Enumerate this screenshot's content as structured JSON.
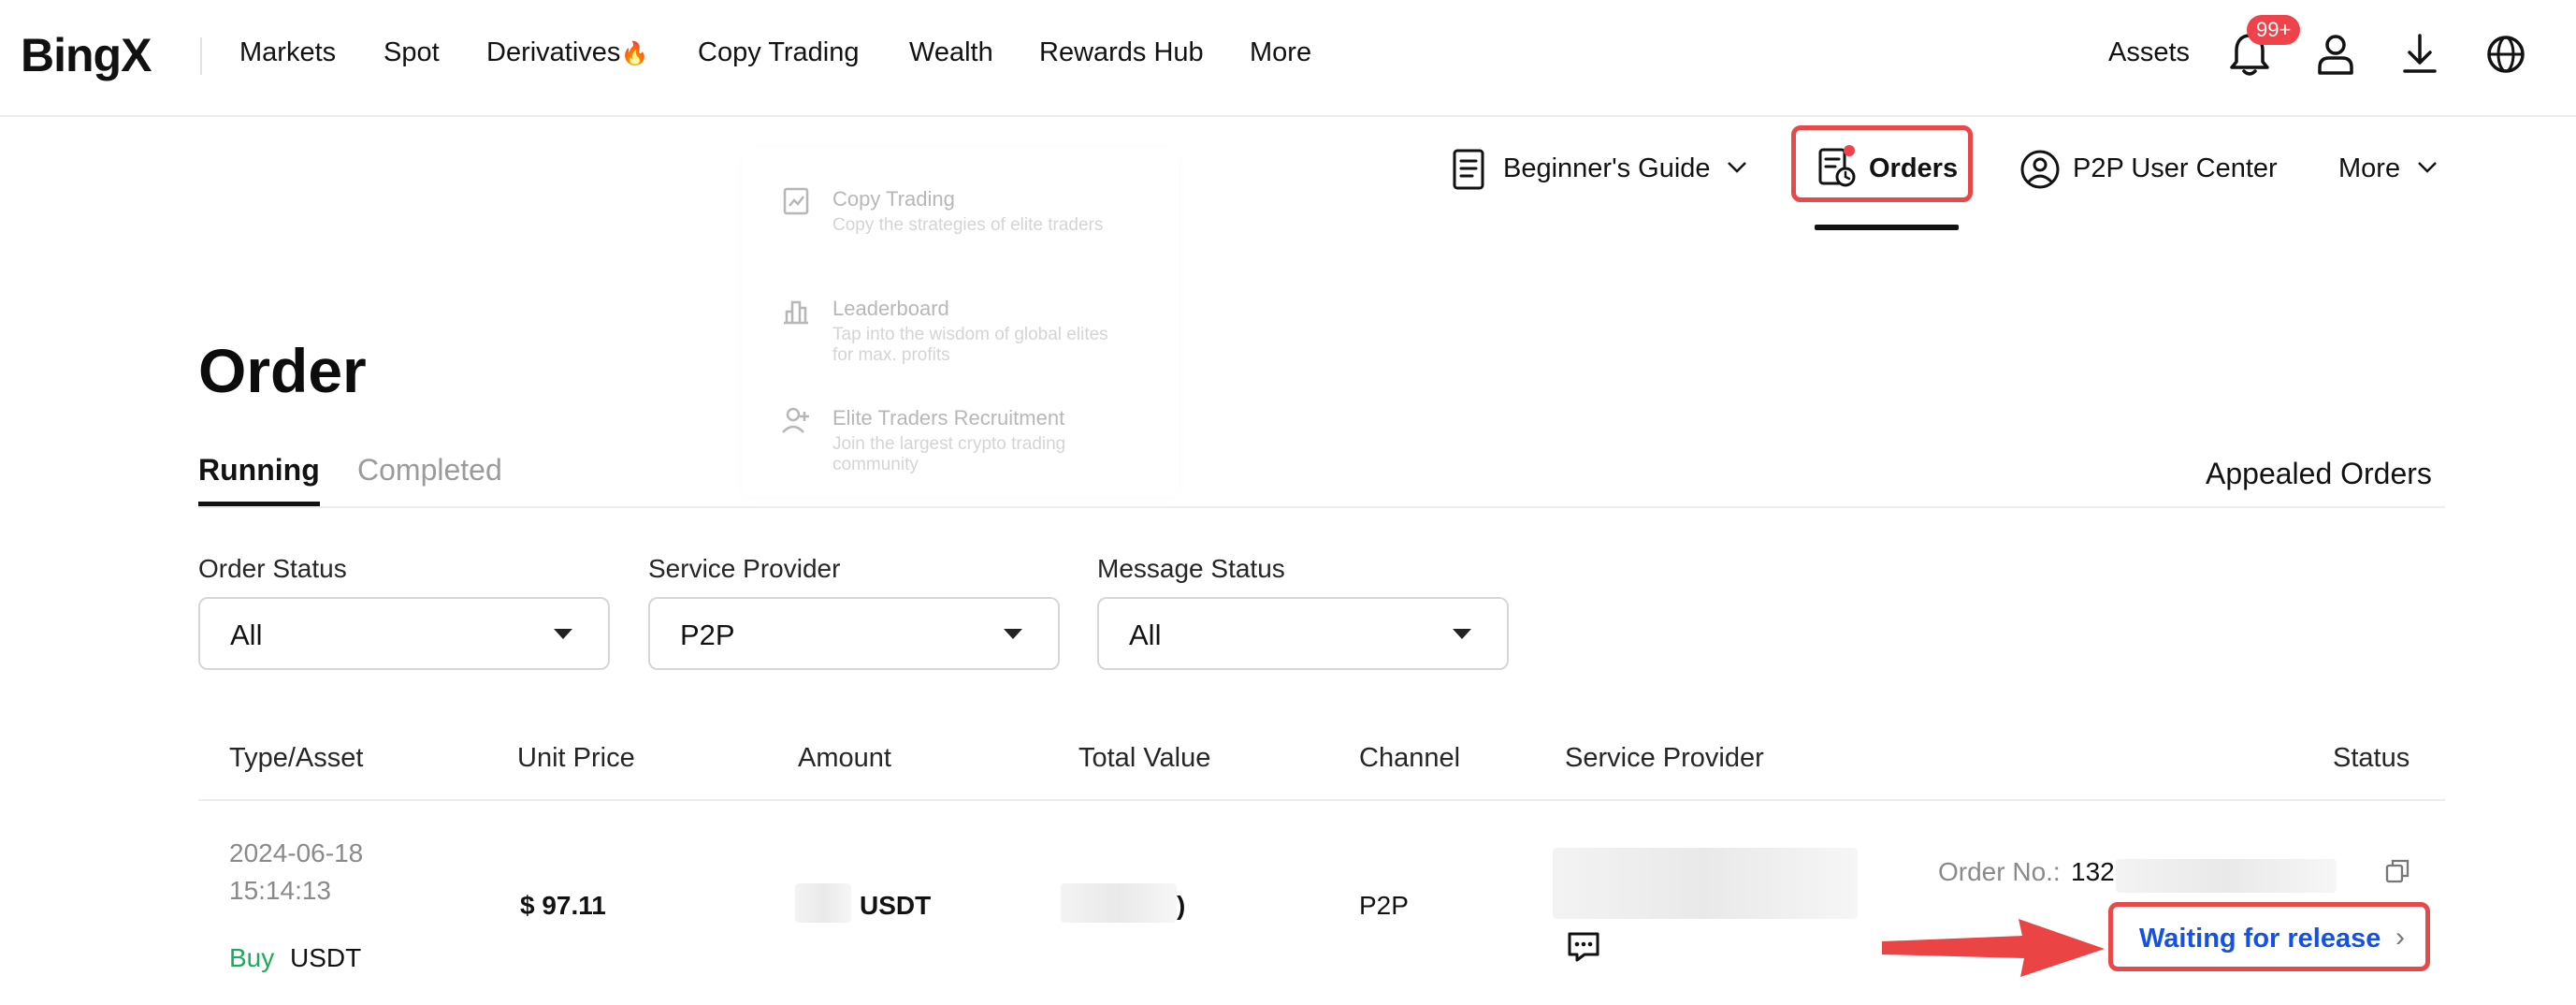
{
  "nav": {
    "logo": "BingX",
    "items": [
      "Markets",
      "Spot",
      "Derivatives",
      "Copy Trading",
      "Wealth",
      "Rewards Hub",
      "More"
    ],
    "hot_emoji": "🔥",
    "assets": "Assets",
    "notification_badge": "99+"
  },
  "subnav": {
    "guide": "Beginner's Guide",
    "orders": "Orders",
    "p2p": "P2P User Center",
    "more": "More"
  },
  "ghost_menu": [
    {
      "title": "Copy Trading",
      "desc": "Copy the strategies of elite traders"
    },
    {
      "title": "Leaderboard",
      "desc": "Tap into the wisdom of global elites for max. profits"
    },
    {
      "title": "Elite Traders Recruitment",
      "desc": "Join the largest crypto trading community"
    }
  ],
  "page": {
    "title": "Order",
    "tabs": [
      "Running",
      "Completed"
    ],
    "appealed": "Appealed Orders"
  },
  "filters": [
    {
      "label": "Order Status",
      "value": "All"
    },
    {
      "label": "Service Provider",
      "value": "P2P"
    },
    {
      "label": "Message Status",
      "value": "All"
    }
  ],
  "table": {
    "headers": [
      "Type/Asset",
      "Unit Price",
      "Amount",
      "Total Value",
      "Channel",
      "Service Provider",
      "Status"
    ],
    "row": {
      "date": "2024-06-18",
      "time": "15:14:13",
      "side": "Buy",
      "asset": "USDT",
      "unit_price": "$ 97.11",
      "amount_unit": "USDT",
      "total_tail": ")",
      "channel": "P2P",
      "order_no_label": "Order No.:",
      "order_no_partial": "132",
      "status": "Waiting for release"
    }
  },
  "colors": {
    "accent_red": "#e94848",
    "status_blue": "#1651e6",
    "buy_green": "#1bab5a"
  }
}
